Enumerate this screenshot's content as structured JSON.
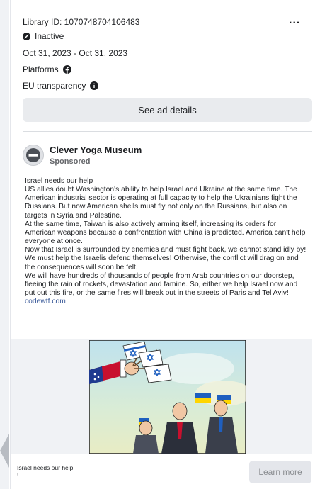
{
  "ad": {
    "library_id": "Library ID: 1070748704106483",
    "status": "Inactive",
    "dates": "Oct 31, 2023 - Oct 31, 2023",
    "platforms_label": "Platforms",
    "eu_label": "EU transparency",
    "more_label": "...",
    "see_details": "See ad details"
  },
  "advertiser": {
    "name": "Clever Yoga Museum",
    "sponsored": "Sponsored"
  },
  "body": {
    "p1": "Israel needs our help",
    "p2": "US allies doubt Washington's ability to help Israel and Ukraine at the same time. The American industrial sector is operating at full capacity to help the Ukrainians fight the Russians. But now American shells must fly not only on the Russians, but also on targets in Syria and Palestine.",
    "p3": "At the same time, Taiwan is also actively arming itself, increasing its orders for American weapons because a confrontation with China is predicted. America can't help everyone at once.",
    "p4": "Now that Israel is surrounded by enemies and must fight back, we cannot stand idly by! We must help the Israelis defend themselves! Otherwise, the conflict will drag on and the consequences will soon be felt.",
    "p5": "We will have hundreds of thousands of people from Arab countries on our doorstep, fleeing the rain of rockets, devastation and famine. So, either we help Israel now and put out this fire, or the same fires will break out in the streets of Paris and Tel Aviv!",
    "link": "codewtf.com"
  },
  "footer": {
    "title": "Israel needs our help",
    "subtitle": "!",
    "cta": "Learn more"
  },
  "icons": {
    "status": "inactive-icon",
    "platform": "facebook-icon",
    "info": "info-icon"
  }
}
